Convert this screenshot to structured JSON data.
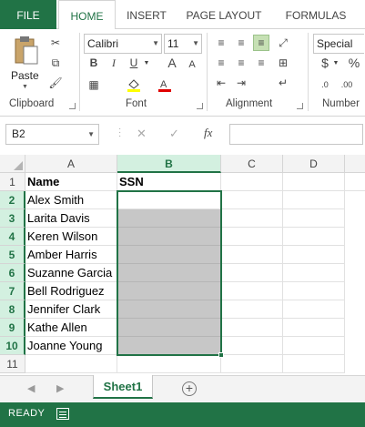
{
  "ribbon_tabs": [
    {
      "label": "FILE"
    },
    {
      "label": "HOME"
    },
    {
      "label": "INSERT"
    },
    {
      "label": "PAGE LAYOUT"
    },
    {
      "label": "FORMULAS"
    }
  ],
  "ribbon": {
    "clipboard": {
      "paste_label": "Paste",
      "group_label": "Clipboard"
    },
    "font": {
      "font_name": "Calibri",
      "font_size": "11",
      "group_label": "Font",
      "bold": "B",
      "italic": "I",
      "underline": "U",
      "grow": "A",
      "shrink": "A"
    },
    "alignment": {
      "group_label": "Alignment"
    },
    "number": {
      "format": "Special",
      "currency": "$",
      "percent": "%",
      "group_label": "Number"
    }
  },
  "formula_bar": {
    "name_box": "B2",
    "fx": "fx",
    "cancel": "✕",
    "enter": "✓",
    "value": ""
  },
  "columns": [
    "A",
    "B",
    "C",
    "D"
  ],
  "rows": [
    "1",
    "2",
    "3",
    "4",
    "5",
    "6",
    "7",
    "8",
    "9",
    "10",
    "11"
  ],
  "cells": {
    "headers": {
      "name": "Name",
      "ssn": "SSN"
    },
    "names": [
      "Alex Smith",
      "Larita Davis",
      "Keren Wilson",
      "Amber Harris",
      "Suzanne Garcia",
      "Bell Rodriguez",
      "Jennifer Clark",
      "Kathe Allen",
      "Joanne Young"
    ]
  },
  "active_cell": "B2",
  "sheet_tabs": [
    {
      "label": "Sheet1"
    }
  ],
  "status_bar": {
    "ready": "READY"
  },
  "colors": {
    "accent": "#217346",
    "shaded_cell": "#c7c7c7"
  }
}
